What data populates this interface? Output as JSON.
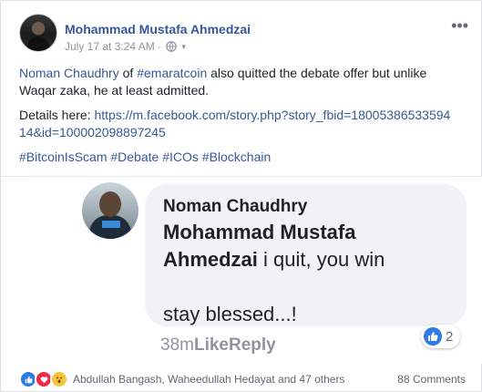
{
  "post": {
    "author": "Mohammad Mustafa Ahmedzai",
    "timestamp": "July 17 at 3:24 AM",
    "separator": "·",
    "privacy_icon": "globe-icon",
    "more_icon": "more-horizontal-icon",
    "text": {
      "mention": "Noman Chaudhry",
      "of": " of ",
      "hashtag_inline": "#emaratcoin",
      "rest": " also quitted the debate offer but unlike Waqar zaka, he at least admitted.",
      "details_label": "Details here: ",
      "details_link": "https://m.facebook.com/story.php?story_fbid=1800538653359414&id=100002098897245",
      "hashtags": [
        {
          "label": "#BitcoinIsScam"
        },
        {
          "label": "#Debate"
        },
        {
          "label": "#ICOs"
        },
        {
          "label": "#Blockchain"
        }
      ]
    }
  },
  "comment_image": {
    "commenter": "Noman Chaudhry",
    "mention": "Mohammad Mustafa Ahmedzai",
    "text_after_mention": " i quit, you win",
    "line2": "stay blessed...!",
    "reaction_count": "2",
    "time": "38m",
    "like_label": "Like",
    "reply_label": "Reply"
  },
  "footer": {
    "reactions": [
      "like",
      "love",
      "wow"
    ],
    "names": "Abdullah Bangash, Waheedullah Hedayat and 47 others",
    "comments": "88 Comments"
  },
  "colors": {
    "link": "#365899",
    "meta": "#90949c",
    "like_blue": "#2f7be6",
    "love_red": "#f0284a",
    "wow_yellow": "#f7c33b"
  }
}
